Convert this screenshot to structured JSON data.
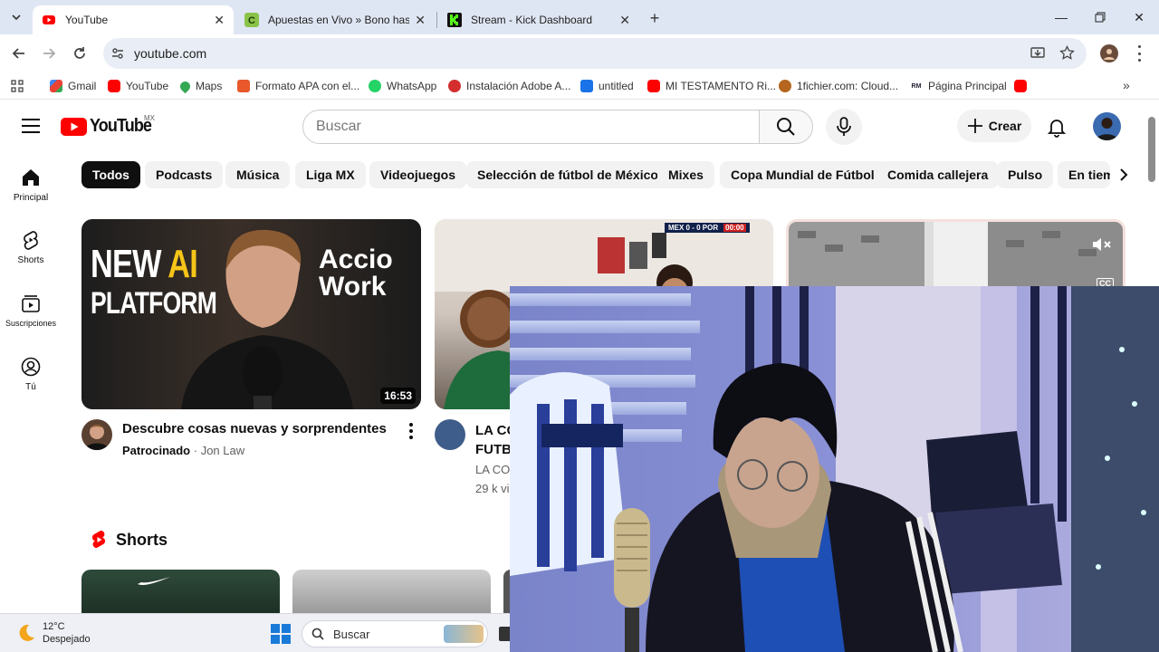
{
  "browser": {
    "tabs": [
      {
        "title": "YouTube",
        "active": true
      },
      {
        "title": "Apuestas en Vivo » Bono hasta"
      },
      {
        "title": "Stream - Kick Dashboard"
      }
    ],
    "url": "youtube.com",
    "bookmarks": [
      "Gmail",
      "YouTube",
      "Maps",
      "Formato APA con el...",
      "WhatsApp",
      "Instalación Adobe A...",
      "untitled",
      "MI TESTAMENTO Ri...",
      "1fichier.com: Cloud...",
      "Página Principal"
    ]
  },
  "youtube": {
    "logo_text": "YouTube",
    "region": "MX",
    "search_placeholder": "Buscar",
    "create_label": "Crear",
    "nav": [
      "Principal",
      "Shorts",
      "Suscripciones",
      "Tú"
    ],
    "chips": [
      "Todos",
      "Podcasts",
      "Música",
      "Liga MX",
      "Videojuegos",
      "Selección de fútbol de México",
      "Mixes",
      "Copa Mundial de Fútbol",
      "Comida callejera",
      "Pulso",
      "En tiem"
    ],
    "videos": [
      {
        "thumb_line1_a": "NEW",
        "thumb_line1_b": "AI",
        "thumb_line2": "PLATFORM",
        "brand_line1": "Accio",
        "brand_line2": "Work",
        "duration": "16:53",
        "title": "Descubre cosas nuevas y sorprendentes",
        "badge": "Patrocinado",
        "channel": "Jon Law"
      },
      {
        "title_line1": "LA CO",
        "title_line2": "FUTB",
        "meta1": "LA CO",
        "meta2": "29 k vi",
        "scoreboard": "MEX 0 - 0 POR",
        "scoreboard_time": "00:00"
      },
      {
        "cc": "CC"
      }
    ],
    "shorts_title": "Shorts"
  },
  "taskbar": {
    "temp": "12°C",
    "weather": "Despejado",
    "search": "Buscar"
  },
  "colors": {
    "youtube_red": "#ff0000",
    "accent_yellow": "#f5c518"
  }
}
